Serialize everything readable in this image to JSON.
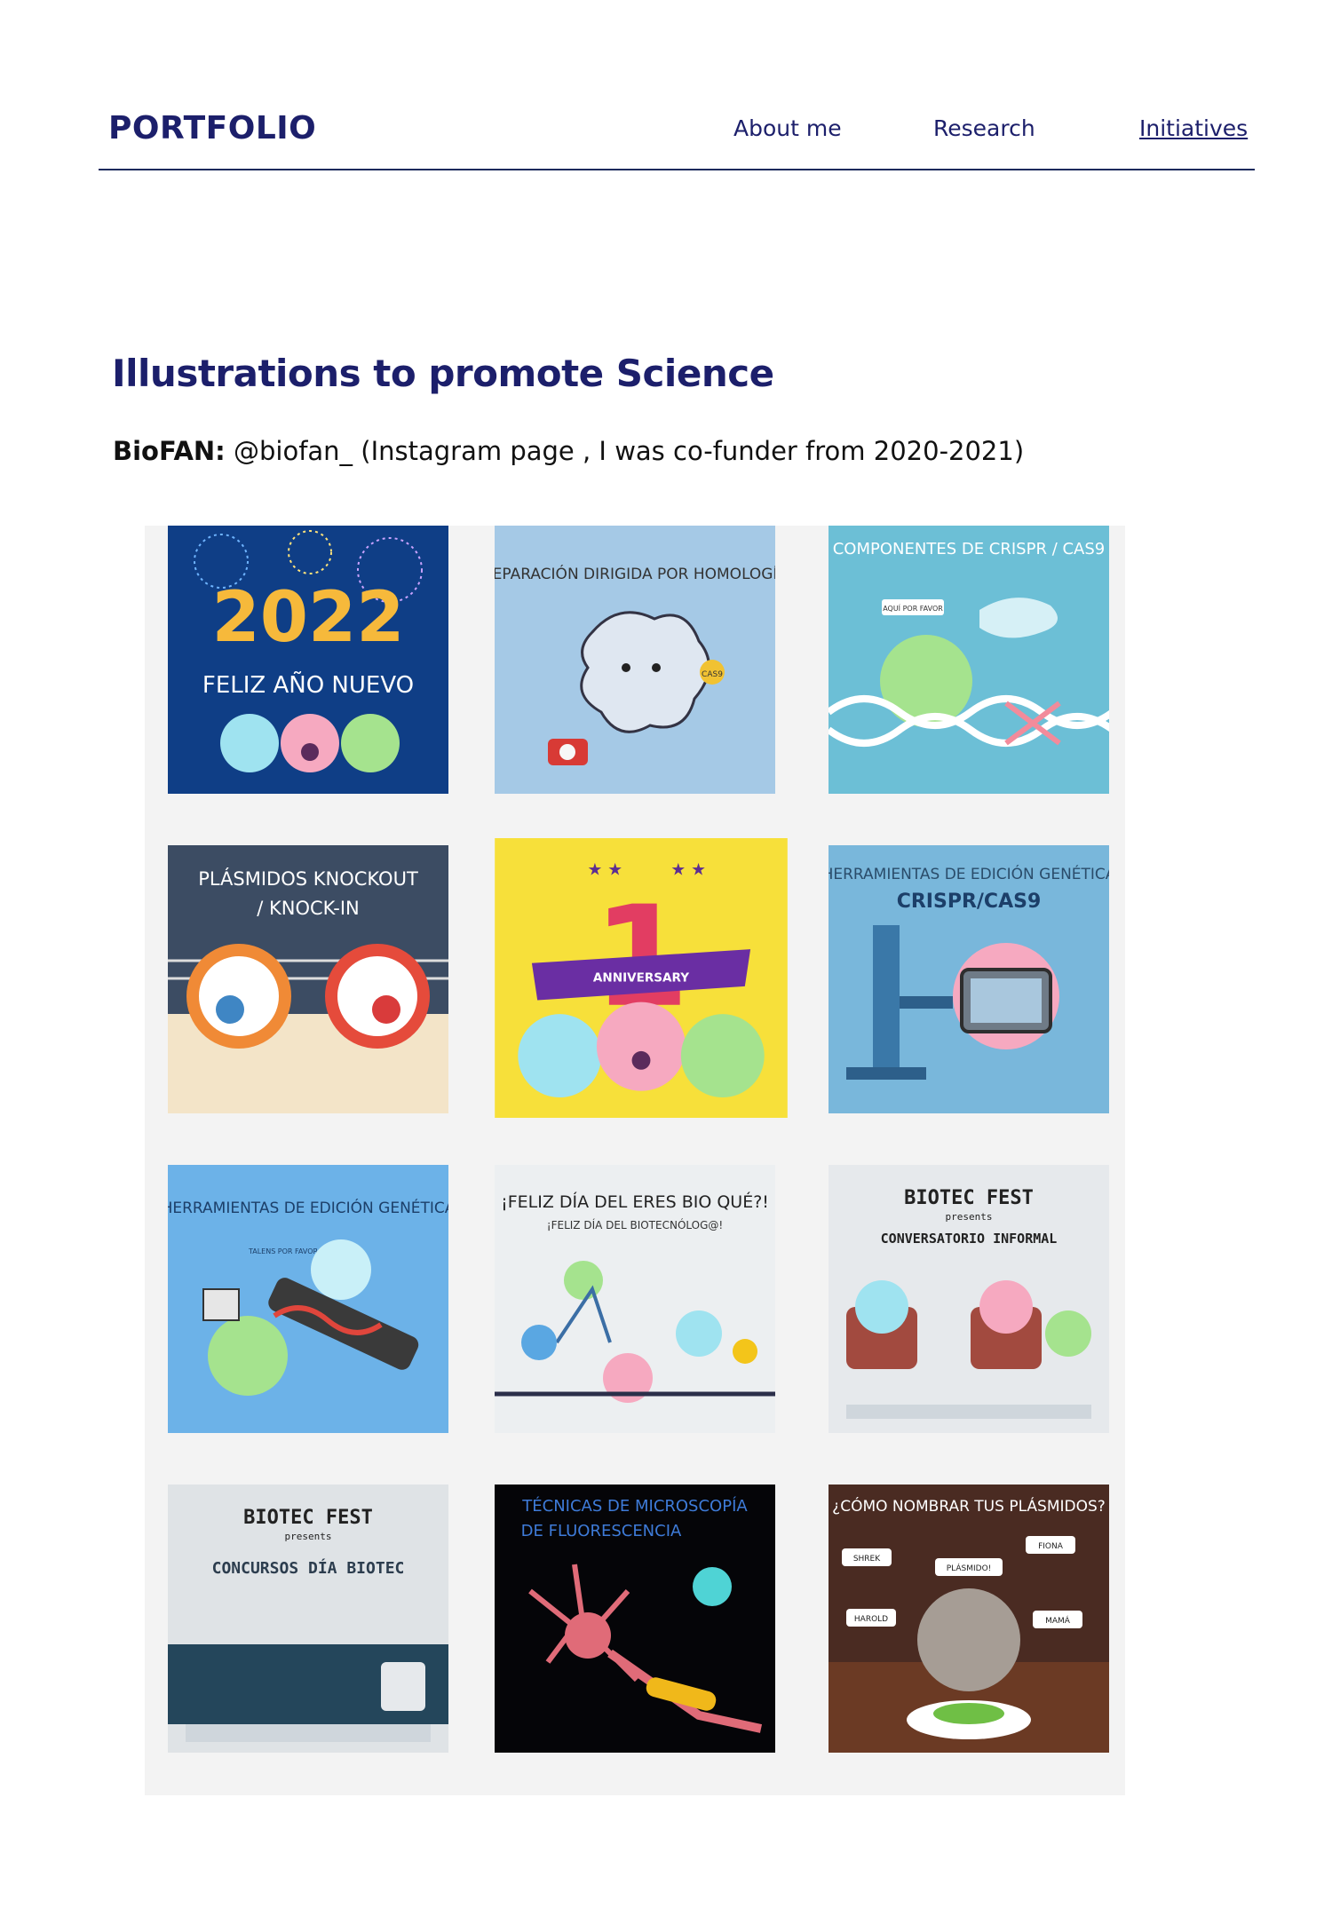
{
  "header": {
    "brand": "PORTFOLIO",
    "nav": [
      {
        "label": "About me"
      },
      {
        "label": "Research"
      },
      {
        "label": "Initiatives",
        "active": true
      }
    ]
  },
  "section": {
    "title": "Illustrations to promote Science",
    "subtitle_bold": "BioFAN:",
    "subtitle_rest": " @biofan_ (Instagram page , I was co-funder from 2020-2021)"
  },
  "posts": [
    {
      "line1": "2022",
      "line2": "FELIZ AÑO NUEVO",
      "bg": "#0f3e86"
    },
    {
      "line1": "REPARACIÓN DIRIGIDA POR HOMOLOGÍA",
      "line2": "CAS9",
      "bg": "#a5c9e6"
    },
    {
      "line1": "COMPONENTES DE CRISPR / CAS9",
      "line2": "AQUÍ POR FAVOR",
      "bg": "#6cbfd6"
    },
    {
      "line1": "PLÁSMIDOS KNOCKOUT",
      "line2": "/ KNOCK-IN",
      "bg": "#3c4c63"
    },
    {
      "line1": "1",
      "line2": "ANNIVERSARY",
      "bg": "#f7e03a"
    },
    {
      "line1": "HERRAMIENTAS DE EDICIÓN GENÉTICA",
      "line2": "CRISPR/CAS9",
      "bg": "#79b7db"
    },
    {
      "line1": "HERRAMIENTAS DE EDICIÓN GENÉTICA",
      "line2": "TALENS POR FAVOR",
      "bg": "#6cb2e8"
    },
    {
      "line1": "¡FELIZ DÍA DEL ERES BIO QUÉ?!",
      "line2": "¡FELIZ DÍA DEL BIOTECNÓLOG@!",
      "bg": "#eceff1"
    },
    {
      "line1": "BIOTEC FEST",
      "line2": "presents",
      "line3": "CONVERSATORIO INFORMAL",
      "bg": "#e6e9ec"
    },
    {
      "line1": "BIOTEC FEST",
      "line2": "presents",
      "line3": "CONCURSOS DÍA BIOTEC",
      "bg": "#dfe3e6"
    },
    {
      "line1": "TÉCNICAS DE MICROSCOPÍA",
      "line2": "DE FLUORESCENCIA",
      "bg": "#050508"
    },
    {
      "line1": "¿CÓMO NOMBRAR TUS PLÁSMIDOS?",
      "line2": "SHREK",
      "line3": "PLÁSMIDO!",
      "line4": "FIONA",
      "line5": "HAROLD",
      "line6": "MAMÁ",
      "bg": "#4a2b22"
    }
  ]
}
